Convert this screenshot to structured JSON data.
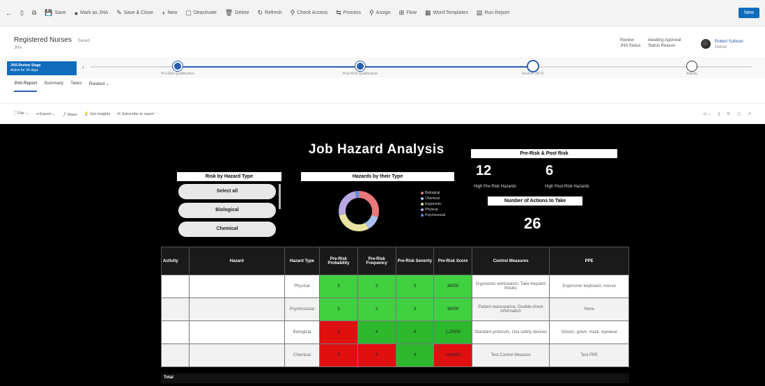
{
  "commands": [
    {
      "icon": "←",
      "label": ""
    },
    {
      "icon": "▯",
      "label": ""
    },
    {
      "icon": "⧉",
      "label": ""
    },
    {
      "icon": "💾",
      "label": "Save"
    },
    {
      "icon": "●",
      "label": "Mark as JHA"
    },
    {
      "icon": "✎",
      "label": "Save & Close"
    },
    {
      "icon": "+",
      "label": "New"
    },
    {
      "icon": "▢",
      "label": "Deactivate"
    },
    {
      "icon": "🗑",
      "label": "Delete"
    },
    {
      "icon": "↻",
      "label": "Refresh"
    },
    {
      "icon": "⚲",
      "label": "Check Access"
    },
    {
      "icon": "⇆",
      "label": "Process"
    },
    {
      "icon": "⚲",
      "label": "Assign"
    },
    {
      "icon": "⊞",
      "label": "Flow"
    },
    {
      "icon": "▦",
      "label": "Word Templates"
    },
    {
      "icon": "▤",
      "label": "Run Report"
    }
  ],
  "new_label": "New",
  "record": {
    "title": "Registered Nurses",
    "saved": "Saved",
    "subtitle": "JHA",
    "meta1_top": "Review",
    "meta1_bottom": "JHA Status",
    "meta2_top": "Awaiting Approval",
    "meta2_bottom": "Status Reason",
    "owner_top": "Robert Sullivan",
    "owner_bottom": "Owner"
  },
  "process": {
    "active_label": "JHA Review Stage",
    "active_sub": "Active for 34 days",
    "stages": [
      "Pre-Risk Qualification",
      "Post-Risk Qualification",
      "Review (28 D)",
      "Activity"
    ]
  },
  "tabs": [
    "JHA Report",
    "Summary",
    "Tasks",
    "Related"
  ],
  "report_toolbar": [
    "File",
    "Export",
    "Share",
    "Get insights",
    "Subscribe to report"
  ],
  "report": {
    "title": "Job Hazard Analysis",
    "risk_by_type_title": "Risk by Hazard Type",
    "slicer": [
      "Select all",
      "Biological",
      "Chemical"
    ],
    "donut_title": "Hazards by their Type",
    "legend": [
      {
        "name": "Biological",
        "color": "#e8787a"
      },
      {
        "name": "Chemical",
        "color": "#a9c0f0"
      },
      {
        "name": "Ergonomic",
        "color": "#e8e2a0"
      },
      {
        "name": "Physical",
        "color": "#b8a8e0"
      },
      {
        "name": "Psychosocial",
        "color": "#5a8be0"
      }
    ],
    "prepost_title": "Pre-Risk & Post Risk",
    "high_pre_value": "12",
    "high_pre_label": "High Pre-Risk Hazards",
    "high_post_value": "6",
    "high_post_label": "High Post-Risk Hazards",
    "actions_title": "Number of Actions to Take",
    "actions_value": "26",
    "total_label": "Total"
  },
  "table": {
    "headers": [
      "Activity",
      "Hazard",
      "Hazard Type",
      "Pre-Risk Probability",
      "Pre-Risk Frequency",
      "Pre-Risk Severity",
      "Pre-Risk Score",
      "Control Measures",
      "PPE"
    ],
    "rows": [
      {
        "type": "Physical",
        "p": "3",
        "f": "3",
        "s": "3",
        "score": "36000",
        "control": "Ergonomic workstation, Take frequent breaks",
        "ppe": "Ergonomic keyboard, mouse"
      },
      {
        "type": "Psychosocial",
        "p": "3",
        "f": "3",
        "s": "3",
        "score": "36000",
        "control": "Patient reassurance, Double-check information",
        "ppe": "None"
      },
      {
        "type": "Biological",
        "p": "5",
        "f": "4",
        "s": "4",
        "score": "1,20000",
        "control": "Standard protocols, Use safety devices",
        "ppe": "Gloves, gown, mask, eyewear"
      },
      {
        "type": "Chemical",
        "p": "5",
        "f": "5",
        "s": "4",
        "score": "1,60000",
        "control": "Test Control Measure",
        "ppe": "Test PPE"
      }
    ]
  }
}
